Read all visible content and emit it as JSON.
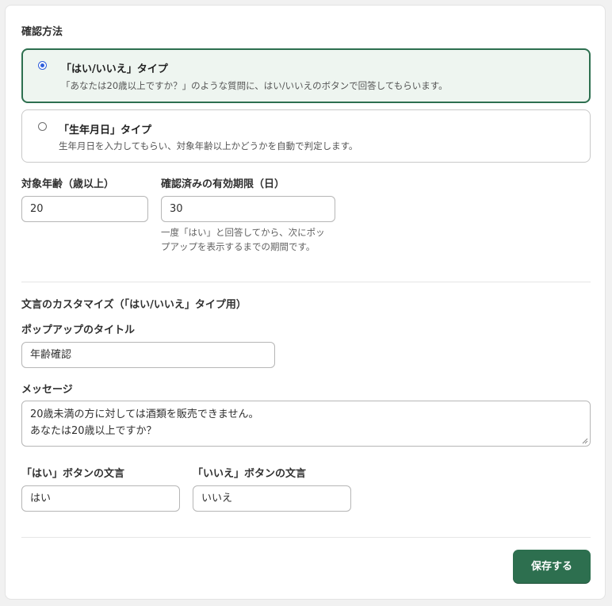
{
  "method": {
    "title": "確認方法",
    "options": [
      {
        "title": "「はい/いいえ」タイプ",
        "description": "「あなたは20歳以上ですか？」のような質問に、はい/いいえのボタンで回答してもらいます。",
        "selected": true
      },
      {
        "title": "「生年月日」タイプ",
        "description": "生年月日を入力してもらい、対象年齢以上かどうかを自動で判定します。",
        "selected": false
      }
    ]
  },
  "age": {
    "label": "対象年齢（歳以上）",
    "value": "20"
  },
  "expiry": {
    "label": "確認済みの有効期限（日）",
    "value": "30",
    "help_line1": "一度「はい」と回答してから、次にポッ",
    "help_line2": "プアップを表示するまでの期間です。"
  },
  "customize": {
    "title": "文言のカスタマイズ（「はい/いいえ」タイプ用）",
    "popup_title_label": "ポップアップのタイトル",
    "popup_title_value": "年齢確認",
    "message_label": "メッセージ",
    "message_line1": "20歳未満の方に対しては酒類を販売できません。",
    "message_line2": "あなたは20歳以上ですか？",
    "yes_label": "「はい」ボタンの文言",
    "yes_value": "はい",
    "no_label": "「いいえ」ボタンの文言",
    "no_value": "いいえ"
  },
  "save_label": "保存する",
  "colors": {
    "accent": "#2d6f4f",
    "selected_bg": "#eef5f0",
    "radio": "#2f5fdc"
  }
}
